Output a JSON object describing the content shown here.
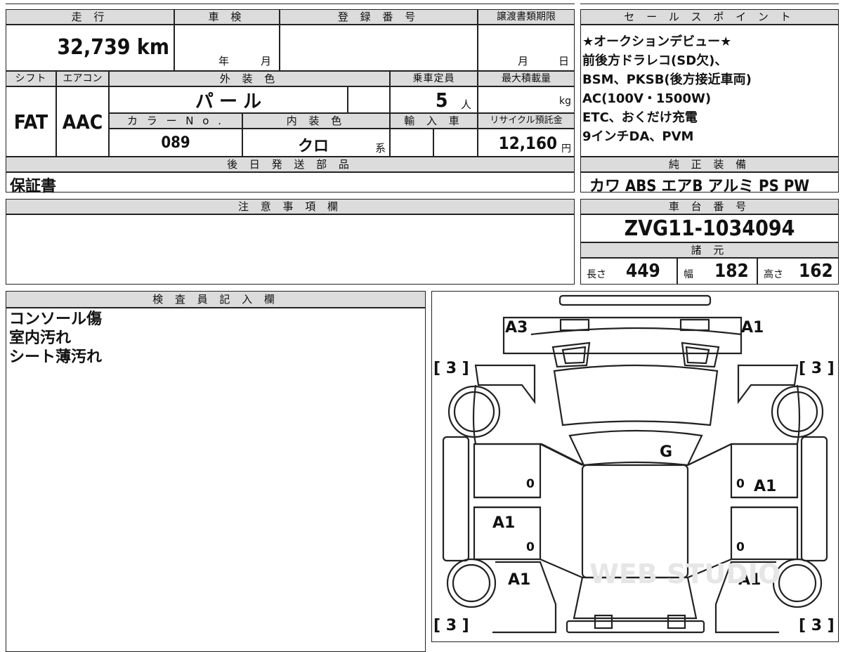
{
  "headers": {
    "mileage": "走 行",
    "inspection": "車 検",
    "registration": "登 録 番 号",
    "transfer_deadline": "譲渡書類期限",
    "sales_point": "セ ー ル ス ポ イ ン ト",
    "shift": "シフト",
    "aircon": "エアコン",
    "exterior_color": "外 装 色",
    "capacity": "乗車定員",
    "max_load": "最大積載量",
    "color_no": "カ ラ ー N o .",
    "interior_color": "内 装 色",
    "import": "輸 入 車",
    "recycle_fee": "リサイクル預託金",
    "later_parts": "後 日 発 送 部 品",
    "genuine_equipment": "純 正 装 備",
    "notes": "注 意 事 項 欄",
    "chassis_number": "車 台 番 号",
    "specs": "諸 元",
    "inspector": "検 査 員 記 入 欄"
  },
  "values": {
    "mileage": "32,739 km",
    "inspection_year": "年",
    "inspection_month": "月",
    "transfer_month": "月",
    "transfer_day": "日",
    "shift": "FAT",
    "aircon": "AAC",
    "exterior_color": "パ ー ル",
    "capacity": "5",
    "capacity_unit": "人",
    "max_load_unit": "kg",
    "color_no": "089",
    "interior_color": "クロ",
    "interior_suffix": "系",
    "recycle_fee": "12,160",
    "recycle_unit": "円",
    "later_parts": "保証書",
    "genuine_equipment": "カワ ABS エアB アルミ PS PW",
    "chassis_number": "ZVG11-1034094",
    "length_label": "長さ",
    "length": "449",
    "width_label": "幅",
    "width": "182",
    "height_label": "高さ",
    "height": "162"
  },
  "sales_points": [
    "★オークションデビュー★",
    "前後方ドラレコ(SD欠)、",
    "BSM、PKSB(後方接近車両)",
    "AC(100V・1500W)",
    "ETC、おくだけ充電",
    "9インチDA、PVM"
  ],
  "inspector_notes": [
    "コンソール傷",
    "室内汚れ",
    "シート薄汚れ"
  ],
  "diagram": {
    "front_left": "A3",
    "front_right": "A1",
    "roof": "G",
    "left_front_door": "A1",
    "right_front_door": "A1",
    "left_rear_quarter": "A1",
    "right_rear_quarter": "A1",
    "tire_fl": "[ 3 ]",
    "tire_fr": "[ 3 ]",
    "tire_rl": "[ 3 ]",
    "tire_rr": "[ 3 ]",
    "zero": "0",
    "watermark": "WEB STUDIO"
  }
}
